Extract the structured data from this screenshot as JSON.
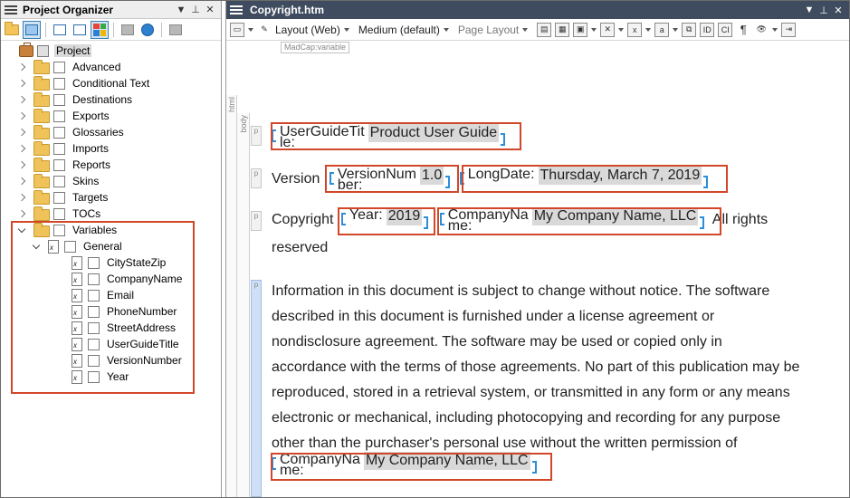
{
  "left_pane": {
    "title": "Project Organizer",
    "controls": [
      "▼",
      "📌",
      "✕"
    ],
    "tree": {
      "root": "Project",
      "folders": [
        "Advanced",
        "Conditional Text",
        "Destinations",
        "Exports",
        "Glossaries",
        "Imports",
        "Reports",
        "Skins",
        "Targets",
        "TOCs",
        "Variables"
      ],
      "variable_set": "General",
      "variables": [
        "CityStateZip",
        "CompanyName",
        "Email",
        "PhoneNumber",
        "StreetAddress",
        "UserGuideTitle",
        "VersionNumber",
        "Year"
      ]
    }
  },
  "right_pane": {
    "title": "Copyright.htm",
    "controls": [
      "▼",
      "📌",
      "✕"
    ],
    "toolbar": {
      "layout": "Layout (Web)",
      "medium": "Medium (default)",
      "page_layout": "Page Layout"
    },
    "tooltip": "MadCap:variable",
    "struct_tags": {
      "html": "html",
      "body": "body",
      "p": "p"
    },
    "content": {
      "p1_var_name": "UserGuideTit\nle:",
      "p1_var_name_a": "UserGuideTit",
      "p1_var_name_b": "le:",
      "p1_var_value": "Product User Guide",
      "p2_prefix": "Version",
      "p2_var1_name_a": "VersionNum",
      "p2_var1_name_b": "ber:",
      "p2_var1_value": "1.0",
      "p2_var2_name": "LongDate:",
      "p2_var2_value": "Thursday, March 7, 2019",
      "p3_prefix": "Copyright",
      "p3_var1_name": "Year:",
      "p3_var1_value": "2019",
      "p3_var2_name_a": "CompanyNa",
      "p3_var2_name_b": "me:",
      "p3_var2_value": "My Company Name, LLC",
      "p3_suffix": "All rights",
      "p3_line2": "reserved",
      "p4_lines": [
        "Information in this document is subject to change without notice. The software",
        "described in this document is furnished under a license agreement or",
        "nondisclosure agreement. The software may be used or copied only in",
        "accordance with the terms of those agreements. No part of this publication may be",
        "reproduced, stored in a retrieval system, or transmitted in any form or any means",
        "electronic or mechanical, including photocopying and recording for any purpose",
        "other than the purchaser's personal use without the written permission of"
      ],
      "p4_var_name_a": "CompanyNa",
      "p4_var_name_b": "me:",
      "p4_var_value": "My Company Name, LLC"
    }
  },
  "colors": {
    "highlight_box": "#d2472a",
    "variable_bracket": "#2a8fd8",
    "editor_titlebar": "#3f4b5e"
  }
}
